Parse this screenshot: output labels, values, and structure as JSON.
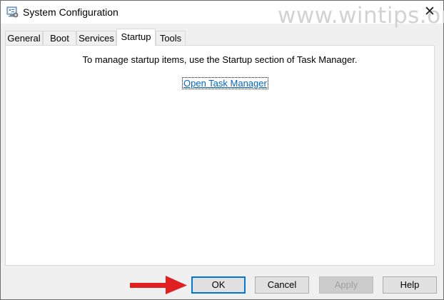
{
  "window": {
    "title": "System Configuration",
    "app_icon": "msconfig-icon",
    "close_glyph": "✕"
  },
  "watermark": "www.wintips.org",
  "tabs": [
    {
      "label": "General",
      "active": false
    },
    {
      "label": "Boot",
      "active": false
    },
    {
      "label": "Services",
      "active": false
    },
    {
      "label": "Startup",
      "active": true
    },
    {
      "label": "Tools",
      "active": false
    }
  ],
  "startup": {
    "message": "To manage startup items, use the Startup section of Task Manager.",
    "link_text": "Open Task Manager"
  },
  "buttons": {
    "ok": "OK",
    "cancel": "Cancel",
    "apply": "Apply",
    "help": "Help"
  },
  "colors": {
    "link": "#0066cc",
    "default_button_border": "#0078d7",
    "annotation_arrow": "#e02020"
  }
}
